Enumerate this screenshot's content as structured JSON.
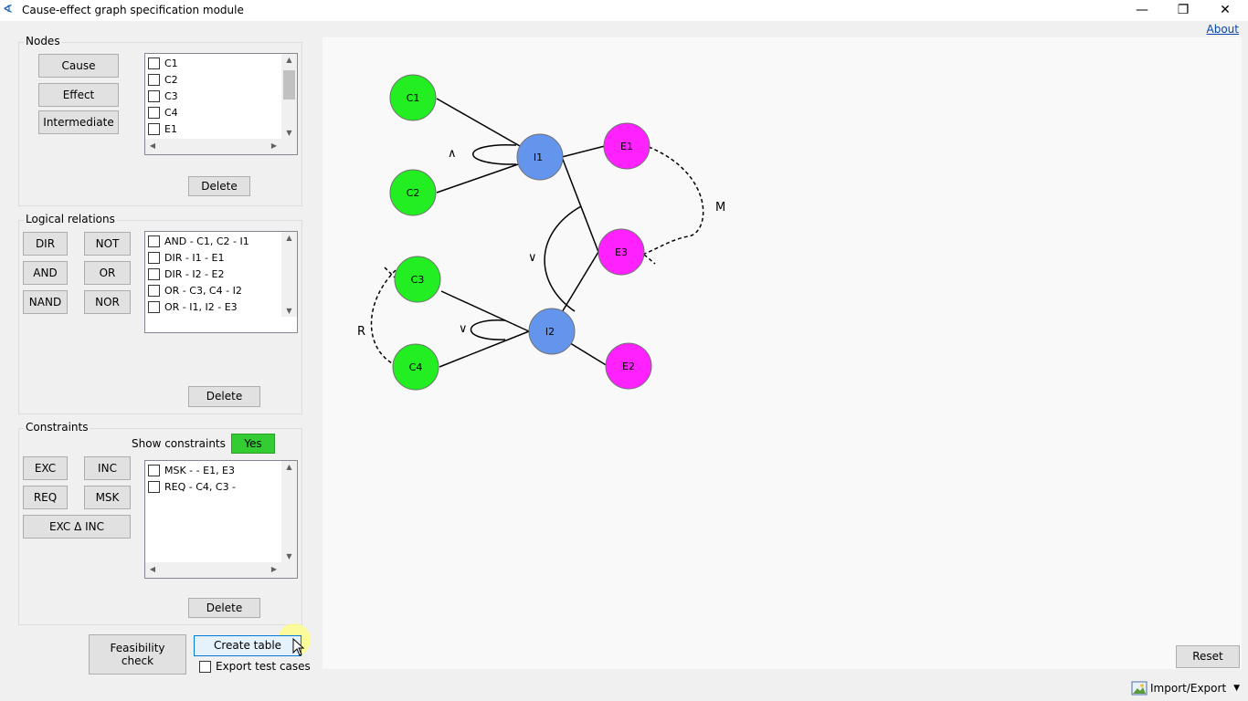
{
  "window": {
    "title": "Cause-effect graph specification module",
    "minimize": "—",
    "maximize": "❐",
    "close": "✕"
  },
  "about": "About",
  "nodes": {
    "title": "Nodes",
    "buttons": {
      "cause": "Cause",
      "effect": "Effect",
      "intermediate": "Intermediate"
    },
    "items": [
      "C1",
      "C2",
      "C3",
      "C4",
      "E1"
    ],
    "delete": "Delete"
  },
  "logical": {
    "title": "Logical relations",
    "buttons": {
      "dir": "DIR",
      "not": "NOT",
      "and": "AND",
      "or": "OR",
      "nand": "NAND",
      "nor": "NOR"
    },
    "items": [
      "AND - C1, C2 - I1",
      "DIR - I1 - E1",
      "DIR - I2 - E2",
      "OR - C3, C4 - I2",
      "OR - I1, I2 - E3"
    ],
    "delete": "Delete"
  },
  "constraints": {
    "title": "Constraints",
    "show_label": "Show constraints",
    "show_value": "Yes",
    "buttons": {
      "exc": "EXC",
      "inc": "INC",
      "req": "REQ",
      "msk": "MSK",
      "exc_inc": "EXC Δ INC"
    },
    "items": [
      "MSK -  - E1, E3",
      "REQ - C4, C3 -"
    ],
    "delete": "Delete"
  },
  "actions": {
    "feasibility": "Feasibility check",
    "create_table": "Create table",
    "export_label": "Export test cases",
    "reset": "Reset",
    "import_export": "Import/Export"
  },
  "graph": {
    "nodes": [
      {
        "id": "C1",
        "type": "cause"
      },
      {
        "id": "C2",
        "type": "cause"
      },
      {
        "id": "C3",
        "type": "cause"
      },
      {
        "id": "C4",
        "type": "cause"
      },
      {
        "id": "I1",
        "type": "intermediate"
      },
      {
        "id": "I2",
        "type": "intermediate"
      },
      {
        "id": "E1",
        "type": "effect"
      },
      {
        "id": "E2",
        "type": "effect"
      },
      {
        "id": "E3",
        "type": "effect"
      }
    ],
    "relation_labels": {
      "and1": "∧",
      "or_c": "∨",
      "or_e3": "∨",
      "msk": "M",
      "req": "R"
    },
    "colors": {
      "cause": "#22ee22",
      "intermediate": "#6495ed",
      "effect": "#ff22ff"
    }
  },
  "icons": {
    "app": "app-logo-icon",
    "import": "picture-icon",
    "dropdown": "chevron-down-icon"
  }
}
